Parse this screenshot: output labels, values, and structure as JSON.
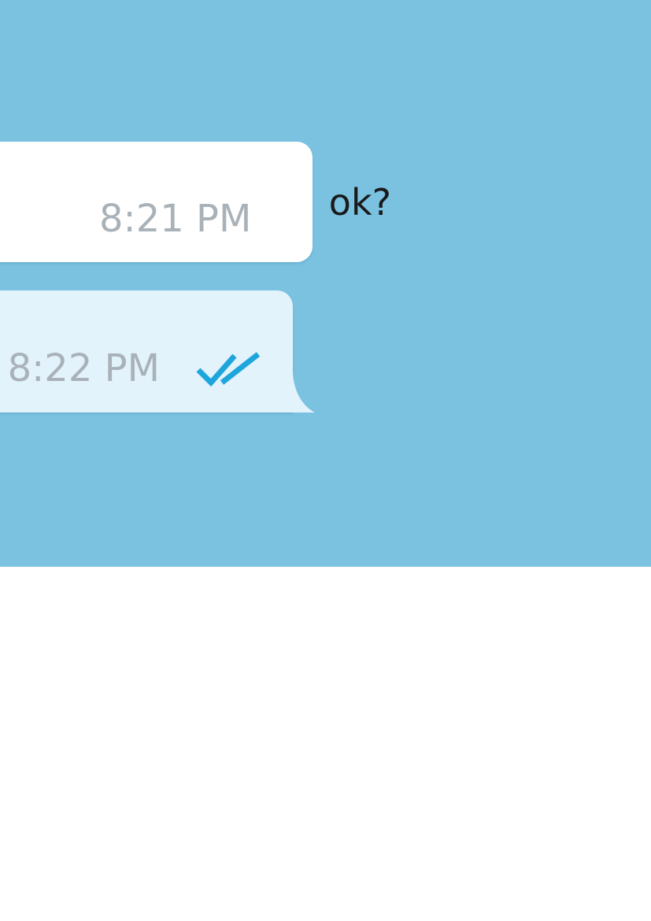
{
  "chat": {
    "background_color": "#7bc2e1",
    "messages": [
      {
        "direction": "incoming",
        "text": "ok?",
        "time": "8:21 PM",
        "bubble_color": "#ffffff"
      },
      {
        "direction": "outgoing",
        "time": "8:22 PM",
        "status_icon": "double-check-icon",
        "status": "read",
        "bubble_color": "#e2f3fc",
        "status_color": "#1ea6dc"
      }
    ]
  }
}
